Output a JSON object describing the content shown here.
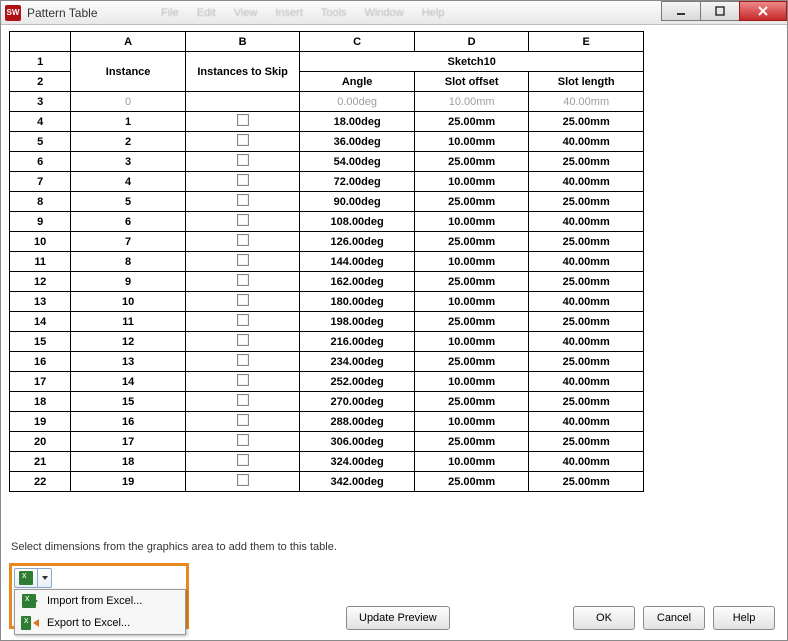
{
  "window": {
    "title": "Pattern Table",
    "app_icon_text": "SW"
  },
  "menubar_blur": [
    "File",
    "Edit",
    "View",
    "Insert",
    "Tools",
    "Window",
    "Help"
  ],
  "cols": {
    "A": "A",
    "B": "B",
    "C": "C",
    "D": "D",
    "E": "E"
  },
  "headers": {
    "instance": "Instance",
    "instances_to_skip": "Instances to Skip",
    "sketch": "Sketch10",
    "angle": "Angle",
    "slot_offset": "Slot offset",
    "slot_length": "Slot length"
  },
  "row3": {
    "idx": "3",
    "instance": "0",
    "skip": "",
    "angle": "0.00deg",
    "offset": "10.00mm",
    "length": "40.00mm"
  },
  "rows": [
    {
      "idx": "4",
      "instance": "1",
      "angle": "18.00deg",
      "offset": "25.00mm",
      "length": "25.00mm"
    },
    {
      "idx": "5",
      "instance": "2",
      "angle": "36.00deg",
      "offset": "10.00mm",
      "length": "40.00mm"
    },
    {
      "idx": "6",
      "instance": "3",
      "angle": "54.00deg",
      "offset": "25.00mm",
      "length": "25.00mm"
    },
    {
      "idx": "7",
      "instance": "4",
      "angle": "72.00deg",
      "offset": "10.00mm",
      "length": "40.00mm"
    },
    {
      "idx": "8",
      "instance": "5",
      "angle": "90.00deg",
      "offset": "25.00mm",
      "length": "25.00mm"
    },
    {
      "idx": "9",
      "instance": "6",
      "angle": "108.00deg",
      "offset": "10.00mm",
      "length": "40.00mm"
    },
    {
      "idx": "10",
      "instance": "7",
      "angle": "126.00deg",
      "offset": "25.00mm",
      "length": "25.00mm"
    },
    {
      "idx": "11",
      "instance": "8",
      "angle": "144.00deg",
      "offset": "10.00mm",
      "length": "40.00mm"
    },
    {
      "idx": "12",
      "instance": "9",
      "angle": "162.00deg",
      "offset": "25.00mm",
      "length": "25.00mm"
    },
    {
      "idx": "13",
      "instance": "10",
      "angle": "180.00deg",
      "offset": "10.00mm",
      "length": "40.00mm"
    },
    {
      "idx": "14",
      "instance": "11",
      "angle": "198.00deg",
      "offset": "25.00mm",
      "length": "25.00mm"
    },
    {
      "idx": "15",
      "instance": "12",
      "angle": "216.00deg",
      "offset": "10.00mm",
      "length": "40.00mm"
    },
    {
      "idx": "16",
      "instance": "13",
      "angle": "234.00deg",
      "offset": "25.00mm",
      "length": "25.00mm"
    },
    {
      "idx": "17",
      "instance": "14",
      "angle": "252.00deg",
      "offset": "10.00mm",
      "length": "40.00mm"
    },
    {
      "idx": "18",
      "instance": "15",
      "angle": "270.00deg",
      "offset": "25.00mm",
      "length": "25.00mm"
    },
    {
      "idx": "19",
      "instance": "16",
      "angle": "288.00deg",
      "offset": "10.00mm",
      "length": "40.00mm"
    },
    {
      "idx": "20",
      "instance": "17",
      "angle": "306.00deg",
      "offset": "25.00mm",
      "length": "25.00mm"
    },
    {
      "idx": "21",
      "instance": "18",
      "angle": "324.00deg",
      "offset": "10.00mm",
      "length": "40.00mm"
    },
    {
      "idx": "22",
      "instance": "19",
      "angle": "342.00deg",
      "offset": "25.00mm",
      "length": "25.00mm"
    }
  ],
  "hint": "Select dimensions from the graphics area to add them to this table.",
  "menu": {
    "import": "Import from Excel...",
    "export": "Export to Excel..."
  },
  "buttons": {
    "update": "Update Preview",
    "ok": "OK",
    "cancel": "Cancel",
    "help": "Help"
  }
}
